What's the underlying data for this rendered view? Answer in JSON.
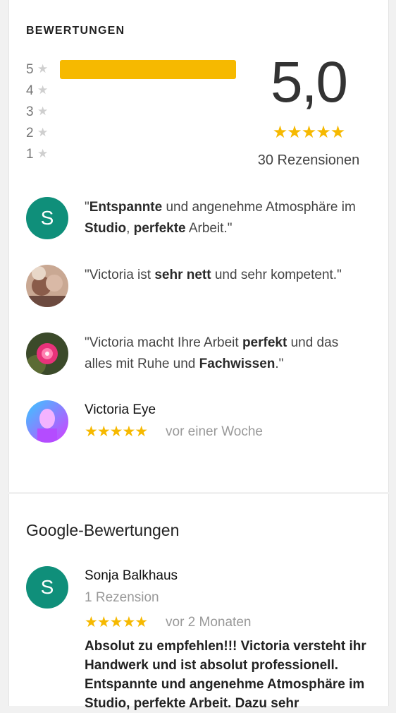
{
  "ratings": {
    "title": "BEWERTUNGEN",
    "histogram": [
      {
        "label": "5",
        "fraction": 1.0
      },
      {
        "label": "4",
        "fraction": 0
      },
      {
        "label": "3",
        "fraction": 0
      },
      {
        "label": "2",
        "fraction": 0
      },
      {
        "label": "1",
        "fraction": 0
      }
    ],
    "score": "5,0",
    "stars": "★★★★★",
    "count_label": "30 Rezensionen"
  },
  "snippets": [
    {
      "avatar_letter": "S",
      "parts": [
        {
          "t": "\"",
          "b": false
        },
        {
          "t": "Entspannte",
          "b": true
        },
        {
          "t": " und angenehme Atmosphäre im ",
          "b": false
        },
        {
          "t": "Studio",
          "b": true
        },
        {
          "t": ", ",
          "b": false
        },
        {
          "t": "perfekte",
          "b": true
        },
        {
          "t": " Arbeit.\"",
          "b": false
        }
      ]
    },
    {
      "avatar_letter": "",
      "parts": [
        {
          "t": "\"Victoria ist ",
          "b": false
        },
        {
          "t": "sehr nett",
          "b": true
        },
        {
          "t": " und sehr kompetent.\"",
          "b": false
        }
      ]
    },
    {
      "avatar_letter": "",
      "parts": [
        {
          "t": "\"Victoria macht Ihre Arbeit ",
          "b": false
        },
        {
          "t": "perfekt",
          "b": true
        },
        {
          "t": " und das alles mit Ruhe und ",
          "b": false
        },
        {
          "t": "Fachwissen",
          "b": true
        },
        {
          "t": ".\"",
          "b": false
        }
      ]
    }
  ],
  "latest": {
    "name": "Victoria Eye",
    "stars": "★★★★★",
    "time": "vor einer Woche"
  },
  "google": {
    "title": "Google-Bewertungen",
    "review": {
      "avatar_letter": "S",
      "name": "Sonja Balkhaus",
      "meta": "1 Rezension",
      "stars": "★★★★★",
      "time": "vor 2 Monaten",
      "text": "Absolut zu empfehlen!!! Victoria versteht ihr Handwerk und ist absolut professionell. Entspannte und angenehme Atmosphäre im Studio, perfekte Arbeit. Dazu sehr"
    }
  },
  "colors": {
    "star": "#f6b900",
    "avatar_teal": "#0f8f7a"
  }
}
